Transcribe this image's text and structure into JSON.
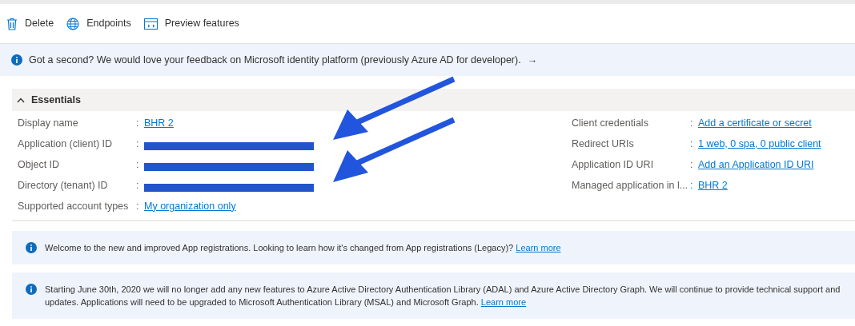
{
  "toolbar": [
    {
      "kind": "delete",
      "label": "Delete"
    },
    {
      "kind": "globe",
      "label": "Endpoints"
    },
    {
      "kind": "preview",
      "label": "Preview features"
    }
  ],
  "feedback_banner": {
    "text": "Got a second? We would love your feedback on Microsoft identity platform (previously Azure AD for developer).",
    "arrow": "→"
  },
  "essentials": {
    "title": "Essentials",
    "expanded": true,
    "left": [
      {
        "label": "Display name",
        "separator": ":",
        "kind": "link",
        "value": "BHR 2"
      },
      {
        "label": "Application (client) ID",
        "separator": ":",
        "kind": "redacted"
      },
      {
        "label": "Object ID",
        "separator": ":",
        "kind": "redacted"
      },
      {
        "label": "Directory (tenant) ID",
        "separator": ":",
        "kind": "redacted"
      },
      {
        "label": "Supported account types",
        "separator": ":",
        "kind": "link",
        "value": "My organization only"
      }
    ],
    "right": [
      {
        "label": "Client credentials",
        "separator": ":",
        "kind": "link",
        "value": "Add a certificate or secret"
      },
      {
        "label": "Redirect URIs",
        "separator": ":",
        "kind": "link",
        "value": "1 web, 0 spa, 0 public client"
      },
      {
        "label": "Application ID URI",
        "separator": ":",
        "kind": "link",
        "value": "Add an Application ID URI"
      },
      {
        "label": "Managed application in l...",
        "separator": ":",
        "kind": "link",
        "value": "BHR 2"
      }
    ]
  },
  "notices": [
    {
      "text": "Welcome to the new and improved App registrations. Looking to learn how it's changed from App registrations (Legacy)?",
      "link": "Learn more"
    },
    {
      "text": "Starting June 30th, 2020 we will no longer add any new features to Azure Active Directory Authentication Library (ADAL) and Azure Active Directory Graph. We will continue to provide technical support and updates. Applications will need to be upgraded to Microsoft Authentication Library (MSAL) and Microsoft Graph.",
      "link": "Learn more"
    }
  ]
}
